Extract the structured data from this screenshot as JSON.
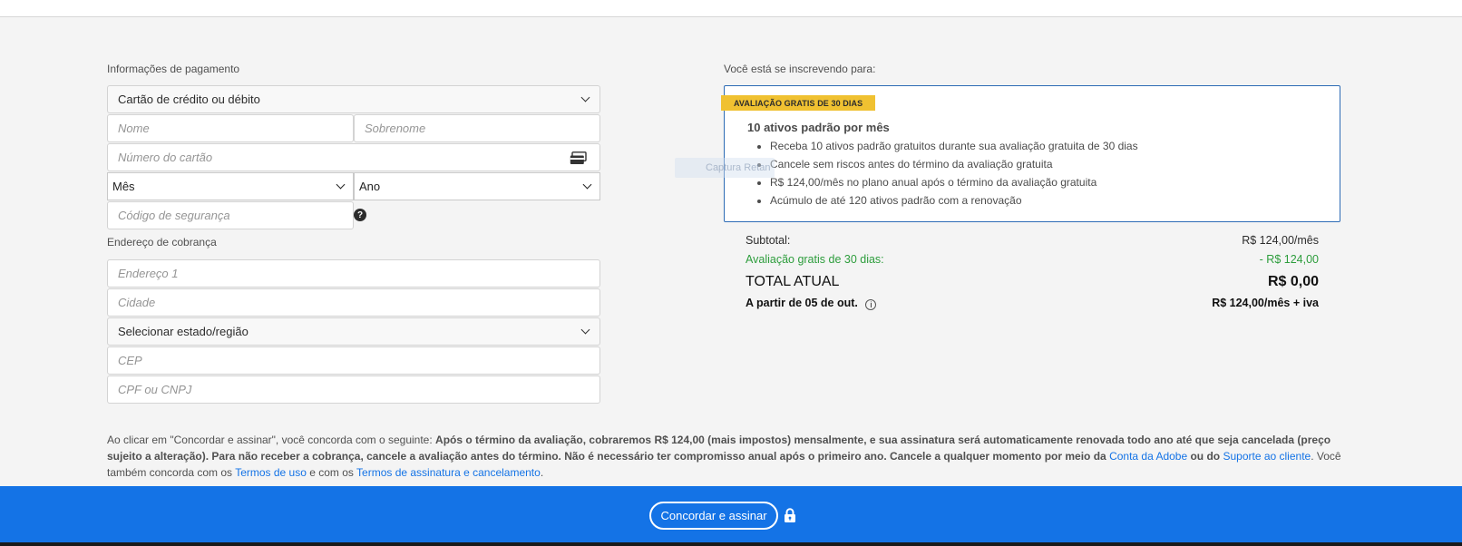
{
  "payment": {
    "section_label": "Informações de pagamento",
    "method_select": "Cartão de crédito ou débito",
    "first_name_placeholder": "Nome",
    "last_name_placeholder": "Sobrenome",
    "card_number_placeholder": "Número do cartão",
    "month_select": "Mês",
    "year_select": "Ano",
    "security_code_placeholder": "Código de segurança",
    "help_glyph": "?"
  },
  "billing": {
    "section_label": "Endereço de cobrança",
    "address_placeholder": "Endereço 1",
    "city_placeholder": "Cidade",
    "state_select": "Selecionar estado/região",
    "zip_placeholder": "CEP",
    "tax_id_placeholder": "CPF ou CNPJ"
  },
  "subscription": {
    "section_label": "Você está se inscrevendo para:",
    "badge": "AVALIAÇÃO GRATIS DE 30 DIAS",
    "plan_title": "10 ativos padrão por mês",
    "features": [
      "Receba 10 ativos padrão gratuitos durante sua avaliação gratuita de 30 dias",
      "Cancele sem riscos antes do término da avaliação gratuita",
      "R$ 124,00/mês no plano anual após o término da avaliação gratuita",
      "Acúmulo de até 120 ativos padrão com a renovação"
    ],
    "ghost_tooltip": "Captura Retan"
  },
  "summary": {
    "subtotal_label": "Subtotal:",
    "subtotal_value": "R$ 124,00/mês",
    "trial_label": "Avaliação gratis de 30 dias:",
    "trial_value": "- R$ 124,00",
    "total_label": "TOTAL ATUAL",
    "total_value": "R$ 0,00",
    "from_label": "A partir de 05 de out.",
    "from_value": "R$ 124,00/mês + iva",
    "info_glyph": "i"
  },
  "legal": {
    "intro": "Ao clicar em \"Concordar e assinar\", você concorda com o seguinte: ",
    "bold_text": "Após o término da avaliação, cobraremos R$ 124,00 (mais impostos) mensalmente, e sua assinatura será automaticamente renovada todo ano até que seja cancelada (preço sujeito a alteração). Para não receber a cobrança, cancele a avaliação antes do término. Não é necessário ter compromisso anual após o primeiro ano. Cancele a qualquer momento por meio da ",
    "link_account": "Conta da Adobe",
    "bold_or": " ou do ",
    "link_support": "Suporte ao cliente",
    "also_agree": ". Você também concorda com os ",
    "link_terms": "Termos de uso",
    "and_text": " e com os ",
    "link_subscription_terms": "Termos de assinatura e cancelamento",
    "period": "."
  },
  "footer": {
    "submit_label": "Concordar e assinar",
    "lock_icon": "lock-icon"
  },
  "colors": {
    "accent": "#1473e6",
    "badge": "#f0c131",
    "trial_green": "#2d9d3c",
    "offer_border": "#2d6bb5"
  }
}
